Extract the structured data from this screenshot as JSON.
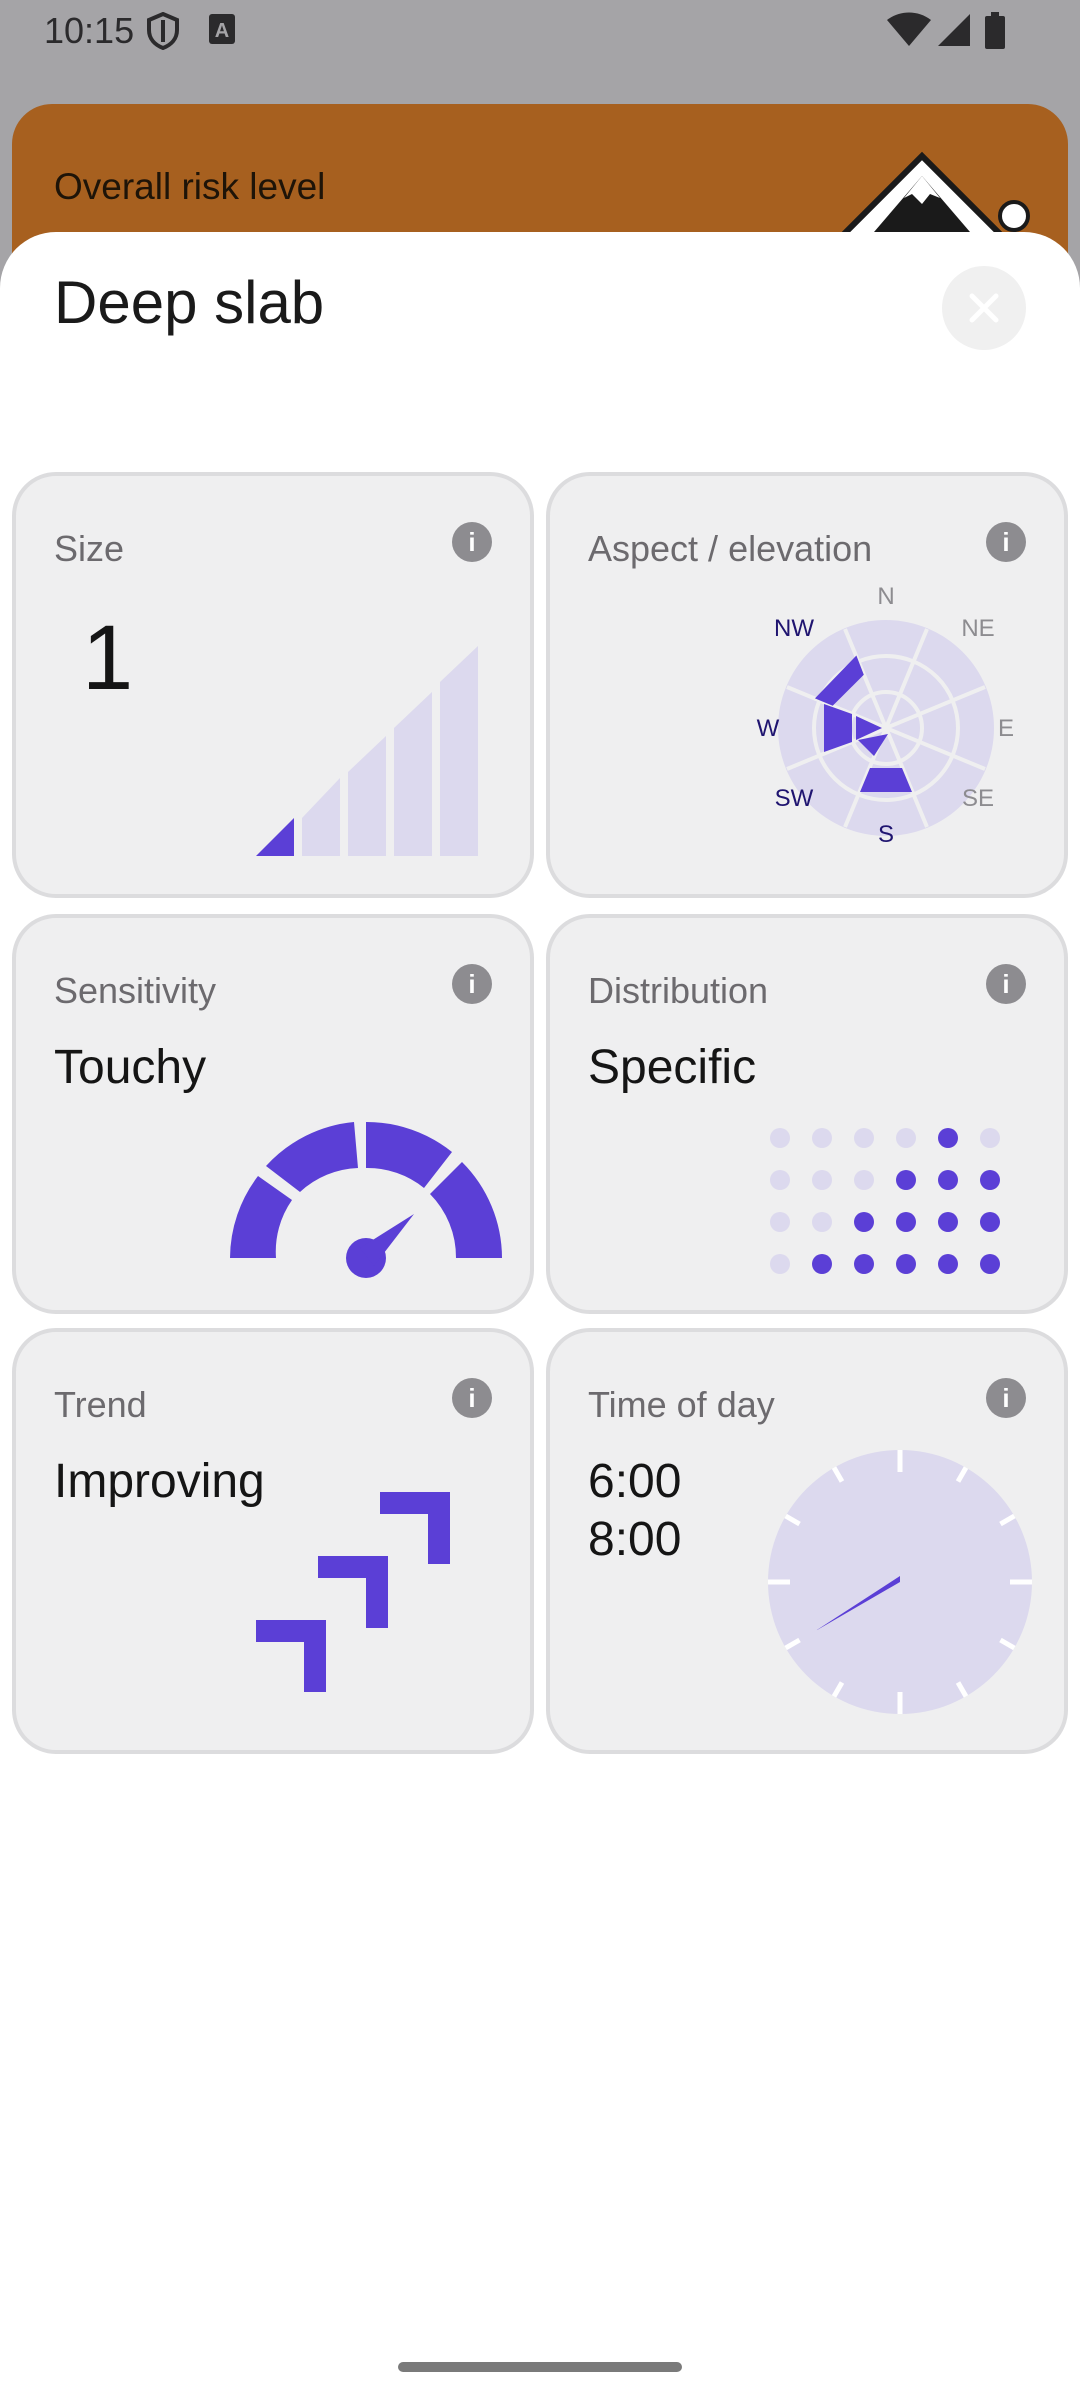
{
  "status_bar": {
    "time": "10:15",
    "icons": [
      "shield-icon",
      "a-badge-icon",
      "wifi-icon",
      "signal-icon",
      "battery-icon"
    ]
  },
  "banner": {
    "label": "Overall risk level",
    "icon": "mountain-danger-icon",
    "color": "#a7601f"
  },
  "sheet": {
    "title": "Deep slab",
    "close_icon": "close-icon"
  },
  "cards": {
    "size": {
      "label": "Size",
      "value": "1",
      "level": 1,
      "max": 5
    },
    "aspect": {
      "label": "Aspect / elevation",
      "directions": [
        "N",
        "NE",
        "E",
        "SE",
        "S",
        "SW",
        "W",
        "NW"
      ],
      "highlighted": [
        "NW",
        "W",
        "S"
      ]
    },
    "sensitivity": {
      "label": "Sensitivity",
      "value": "Touchy"
    },
    "distribution": {
      "label": "Distribution",
      "value": "Specific"
    },
    "trend": {
      "label": "Trend",
      "value": "Improving"
    },
    "time_of_day": {
      "label": "Time of day",
      "start": "6:00",
      "end": "8:00"
    }
  },
  "colors": {
    "accent": "#5b3fd6",
    "accent_light": "#dcd9ee",
    "dark_label": "#1f1470"
  }
}
